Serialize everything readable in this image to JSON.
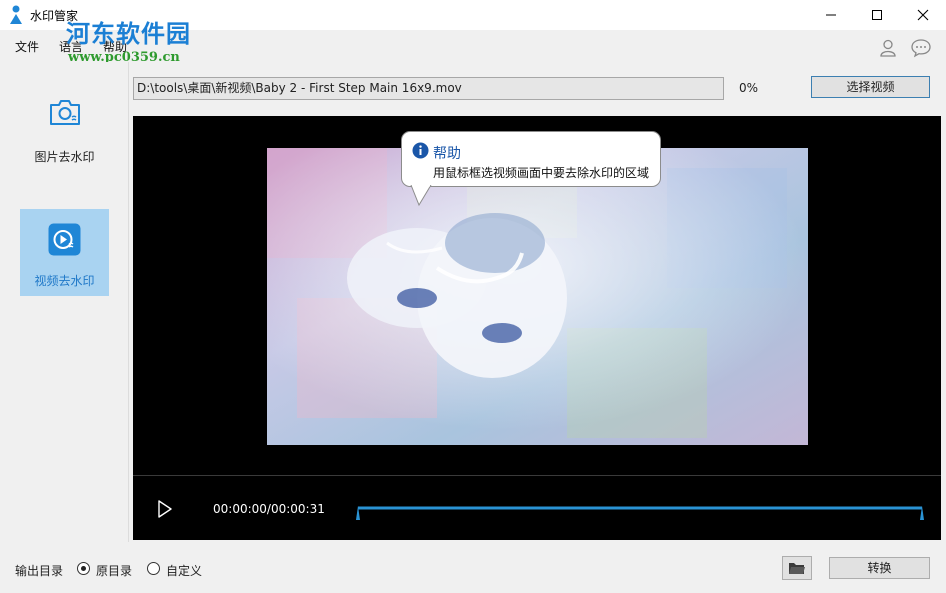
{
  "window": {
    "title": "水印管家",
    "controls": [
      "minimize-icon",
      "maximize-icon",
      "close-icon"
    ]
  },
  "watermark": {
    "logo_text": "河东软件园",
    "url": "www.pc0359.cn"
  },
  "menu": {
    "items": [
      "文件",
      "语言",
      "帮助"
    ]
  },
  "header_icons": [
    "user-icon",
    "chat-icon"
  ],
  "sidebar": {
    "items": [
      {
        "label": "图片去水印",
        "icon": "photo-icon",
        "selected": false
      },
      {
        "label": "视频去水印",
        "icon": "video-icon",
        "selected": true
      }
    ]
  },
  "file": {
    "path": "D:\\tools\\桌面\\新视频\\Baby 2 - First Step Main 16x9.mov",
    "progress": "0%",
    "select_button": "选择视频"
  },
  "tooltip": {
    "title": "帮助",
    "body": "用鼠标框选视频画面中要去除水印的区域"
  },
  "player": {
    "time": "00:00:00/00:00:31",
    "range_start": 0.0,
    "range_end": 1.0
  },
  "output": {
    "label": "输出目录",
    "options": [
      {
        "label": "原目录",
        "checked": true
      },
      {
        "label": "自定义",
        "checked": false
      }
    ],
    "convert_button": "转换"
  },
  "colors": {
    "accent": "#1f86d6",
    "sidebar_selected": "#a9d3f1",
    "video_bg": "#000000",
    "timeline": "#2a93d4"
  }
}
